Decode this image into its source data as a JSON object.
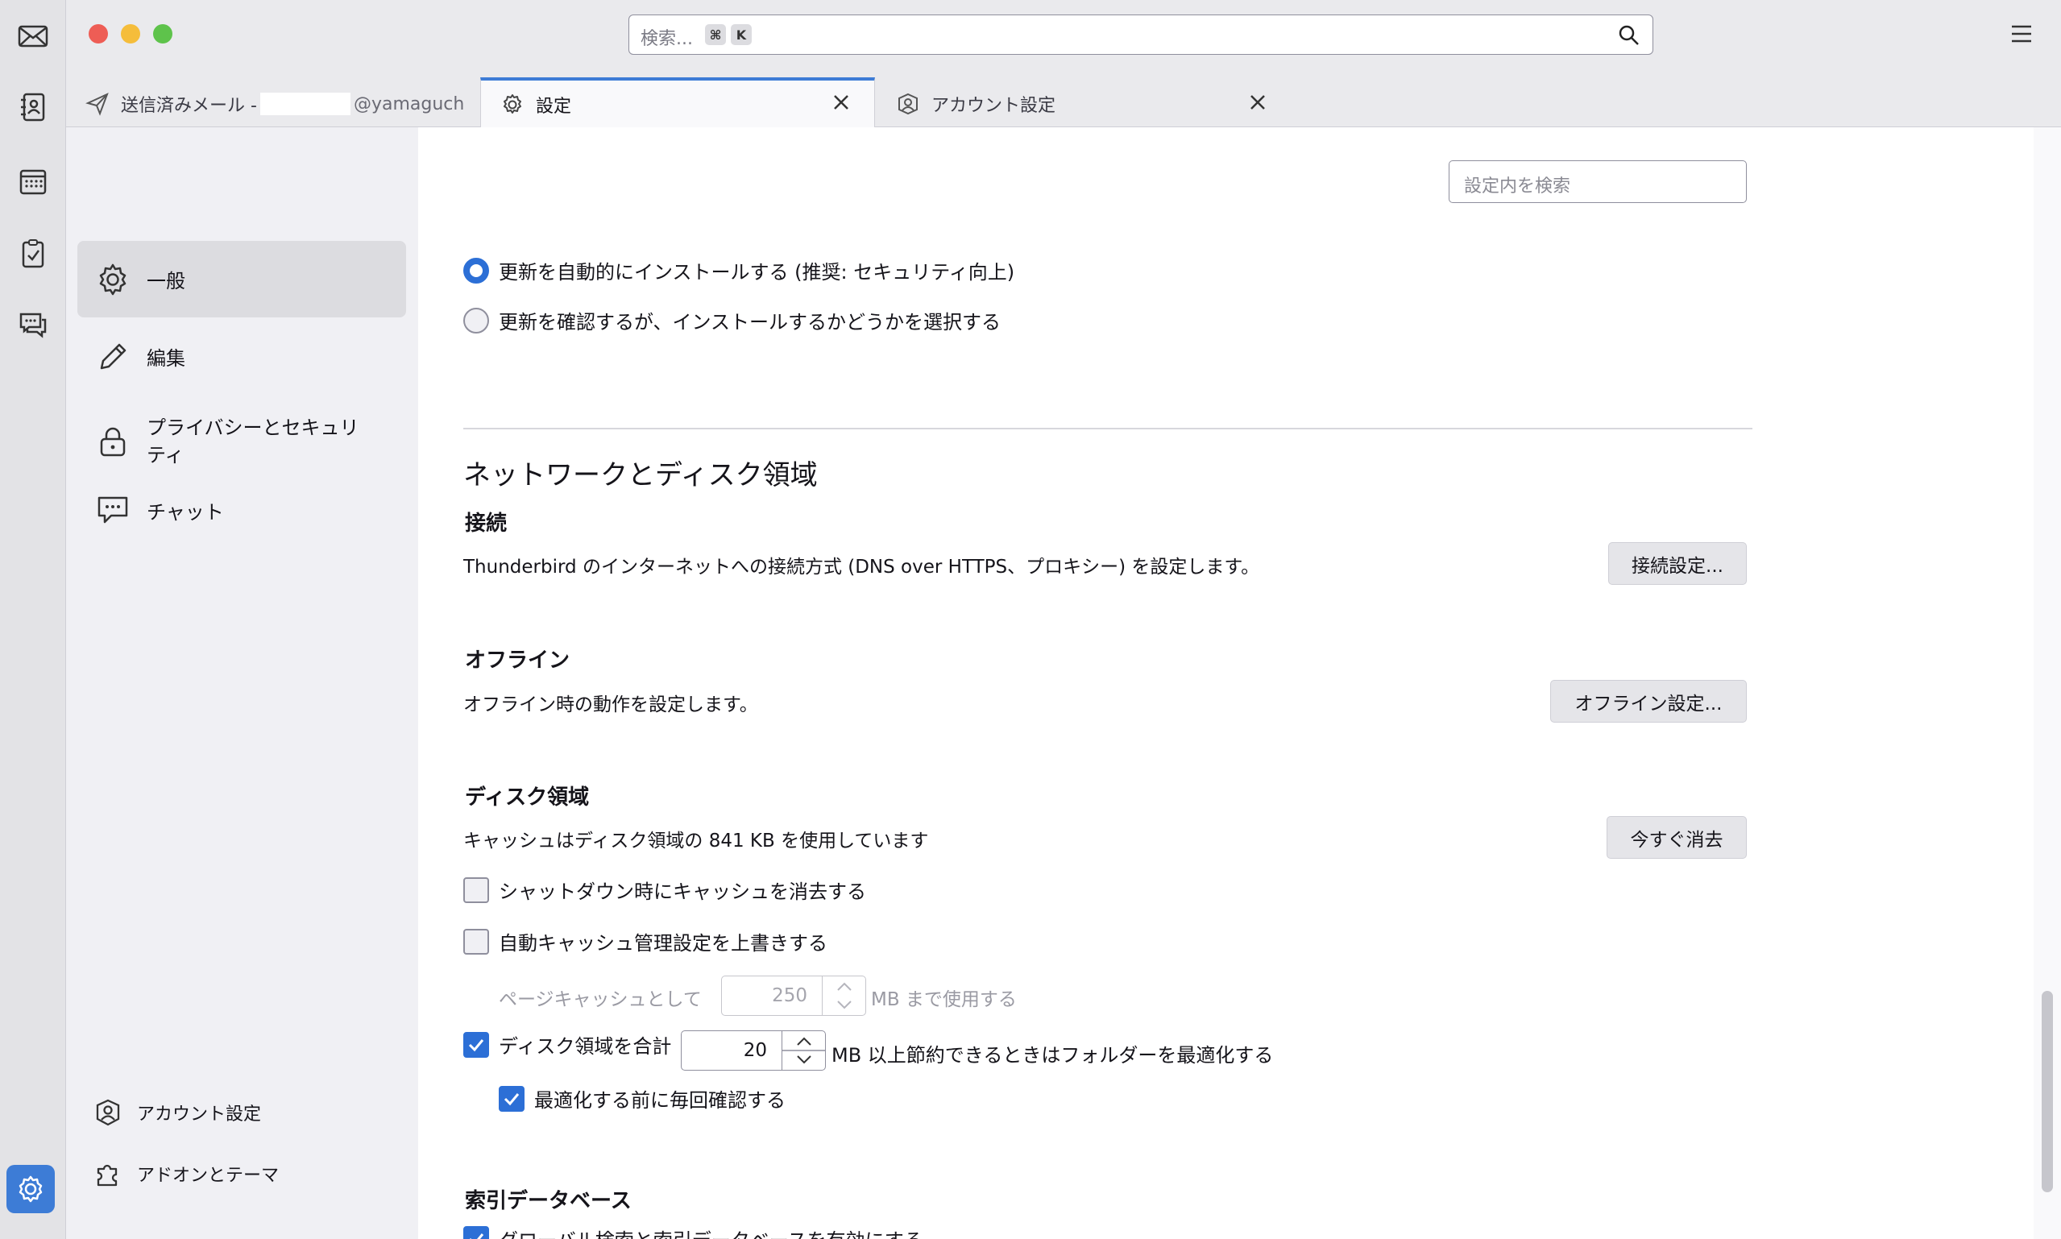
{
  "window": {
    "search_placeholder": "検索...",
    "shortcut_key1": "⌘",
    "shortcut_key2": "K"
  },
  "tabs": [
    {
      "label": "送信済みメール -",
      "suffix": "@yamaguch",
      "icon": "send-icon"
    },
    {
      "label": "設定",
      "icon": "gear-icon",
      "active": true
    },
    {
      "label": "アカウント設定",
      "icon": "account-icon"
    }
  ],
  "nav": {
    "items": [
      {
        "label": "一般",
        "icon": "gear-icon",
        "active": true
      },
      {
        "label": "編集",
        "icon": "pencil-icon"
      },
      {
        "label": "プライバシーとセキュリティ",
        "icon": "lock-icon"
      },
      {
        "label": "チャット",
        "icon": "chat-icon"
      }
    ],
    "footer": [
      {
        "label": "アカウント設定",
        "icon": "account-icon"
      },
      {
        "label": "アドオンとテーマ",
        "icon": "puzzle-icon"
      }
    ]
  },
  "content": {
    "search_placeholder": "設定内を検索",
    "update_auto": "更新を自動的にインストールする (推奨: セキュリティ向上)",
    "update_ask": "更新を確認するが、インストールするかどうかを選択する",
    "network_heading": "ネットワークとディスク領域",
    "connection": {
      "heading": "接続",
      "desc": "Thunderbird のインターネットへの接続方式 (DNS over HTTPS、プロキシー) を設定します。",
      "button": "接続設定..."
    },
    "offline": {
      "heading": "オフライン",
      "desc": "オフライン時の動作を設定します。",
      "button": "オフライン設定..."
    },
    "disk": {
      "heading": "ディスク領域",
      "desc": "キャッシュはディスク領域の 841 KB を使用しています",
      "button": "今すぐ消去",
      "clear_on_shutdown": "シャットダウン時にキャッシュを消去する",
      "override_cache": "自動キャッシュ管理設定を上書きする",
      "page_cache_prefix": "ページキャッシュとして",
      "page_cache_value": "250",
      "page_cache_suffix": "MB まで使用する",
      "compact_prefix": "ディスク領域を合計",
      "compact_value": "20",
      "compact_suffix": "MB 以上節約できるときはフォルダーを最適化する",
      "confirm_compact": "最適化する前に毎回確認する"
    },
    "index": {
      "heading": "索引データベース",
      "enable": "グローバル検索と索引データベースを有効にする"
    }
  },
  "colors": {
    "accent": "#2c6fd6",
    "settings_space": "#3d7cd6"
  }
}
